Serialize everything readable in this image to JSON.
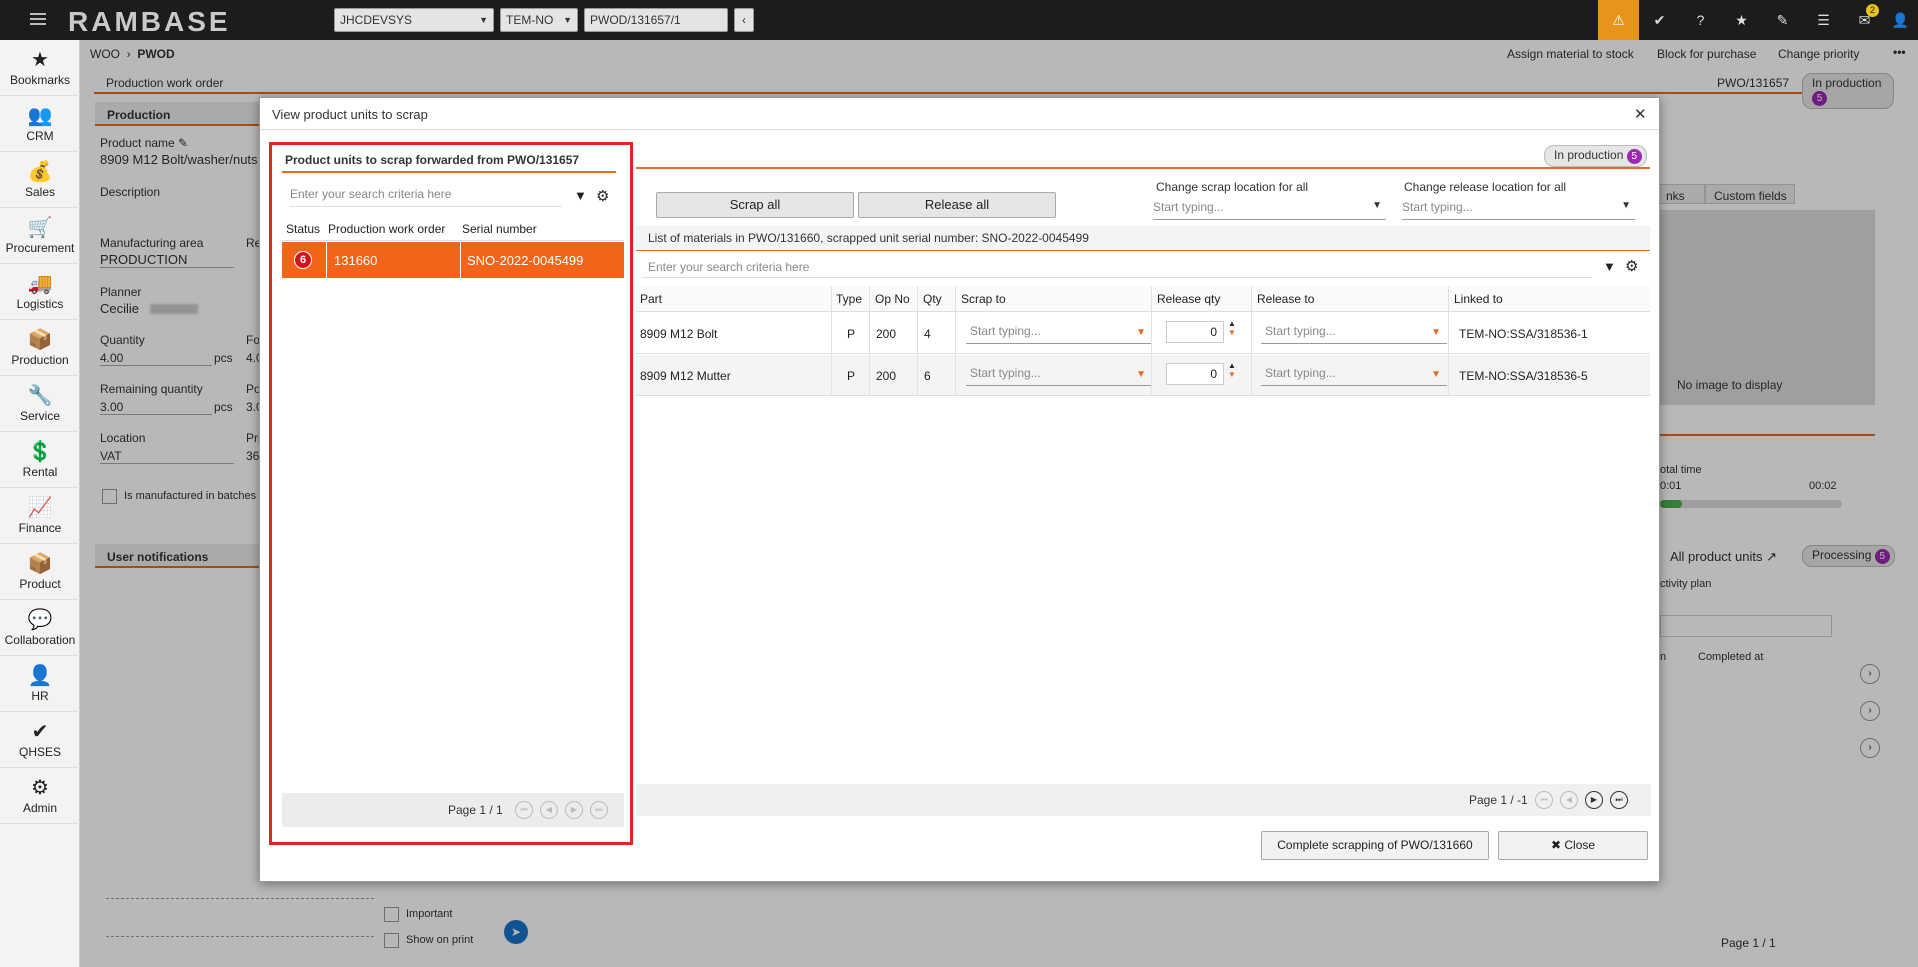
{
  "topbar": {
    "logo": "RAMBASE",
    "company": "JHCDEVSYS",
    "region": "TEM-NO",
    "document": "PWOD/131657/1",
    "notification_count": "2"
  },
  "sidebar": {
    "items": [
      {
        "label": "Bookmarks",
        "icon": "★"
      },
      {
        "label": "CRM",
        "icon": "👥"
      },
      {
        "label": "Sales",
        "icon": "💰"
      },
      {
        "label": "Procurement",
        "icon": "🛒"
      },
      {
        "label": "Logistics",
        "icon": "🚚"
      },
      {
        "label": "Production",
        "icon": "📦"
      },
      {
        "label": "Service",
        "icon": "🔧"
      },
      {
        "label": "Rental",
        "icon": "💲"
      },
      {
        "label": "Finance",
        "icon": "📈"
      },
      {
        "label": "Product",
        "icon": "📦"
      },
      {
        "label": "Collaboration",
        "icon": "💬"
      },
      {
        "label": "HR",
        "icon": "👤"
      },
      {
        "label": "QHSES",
        "icon": "✔"
      },
      {
        "label": "Admin",
        "icon": "⚙"
      }
    ]
  },
  "page": {
    "breadcrumb_root": "WOO",
    "breadcrumb_current": "PWOD",
    "actions": [
      "Assign material to stock",
      "Block for purchase",
      "Change priority"
    ],
    "section_title": "Production work order",
    "doc_id": "PWO/131657",
    "status": "In production",
    "status_num": "5",
    "production_tab": "Production",
    "product_name_label": "Product name",
    "product_name": "8909 M12 Bolt/washer/nuts",
    "description_label": "Description",
    "mfg_area_label": "Manufacturing area",
    "mfg_area": "PRODUCTION",
    "re_label": "Re",
    "planner_label": "Planner",
    "planner": "Cecilie",
    "quantity_label": "Quantity",
    "quantity": "4.00",
    "quantity_unit": "pcs",
    "quantity_right": "4.0",
    "fo_label": "Fo",
    "remaining_label": "Remaining quantity",
    "remaining": "3.00",
    "remaining_unit": "pcs",
    "remaining_right": "3.0",
    "po_label": "Po",
    "location_label": "Location",
    "location": "VAT",
    "pri_label": "Pri",
    "location_right": "36",
    "batches_label": "Is manufactured in batches",
    "user_notif": "User notifications",
    "important": "Important",
    "show_on_print": "Show on print",
    "links_tab": "nks",
    "custom_fields_tab": "Custom fields",
    "no_image": "No image to display",
    "total_time_label": "otal time",
    "time_left": "0:01",
    "time_right": "00:02",
    "all_units_tab": "All product units",
    "processing": "Processing",
    "processing_num": "5",
    "activity_plan": "ctivity plan",
    "col_n": "n",
    "col_completed": "Completed at",
    "pager_bg": "Page 1 / 1"
  },
  "dialog": {
    "title": "View product units to scrap",
    "left": {
      "title": "Product units to scrap forwarded from PWO/131657",
      "search_placeholder": "Enter your search criteria here",
      "headers": [
        "Status",
        "Production work order",
        "Serial number"
      ],
      "rows": [
        {
          "status": "6",
          "pwo": "131660",
          "serial": "SNO-2022-0045499"
        }
      ],
      "pager": "Page 1 / 1"
    },
    "right": {
      "status": "In production",
      "status_num": "5",
      "scrap_all": "Scrap all",
      "release_all": "Release all",
      "scrap_loc_label": "Change scrap location for all",
      "release_loc_label": "Change release location for all",
      "start_typing": "Start typing...",
      "list_title": "List of materials in PWO/131660, scrapped unit serial number: SNO-2022-0045499",
      "search_placeholder": "Enter your search criteria here",
      "headers": [
        "Part",
        "Type",
        "Op No",
        "Qty",
        "Scrap to",
        "Release qty",
        "Release to",
        "Linked to"
      ],
      "rows": [
        {
          "part": "8909 M12 Bolt",
          "type": "P",
          "op": "200",
          "qty": "4",
          "scrap": "Start typing...",
          "rel_qty": "0",
          "release": "Start typing...",
          "linked": "TEM-NO:SSA/318536-1"
        },
        {
          "part": "8909 M12 Mutter",
          "type": "P",
          "op": "200",
          "qty": "6",
          "scrap": "Start typing...",
          "rel_qty": "0",
          "release": "Start typing...",
          "linked": "TEM-NO:SSA/318536-5"
        }
      ],
      "pager": "Page 1 / -1"
    },
    "complete_btn": "Complete scrapping of PWO/131660",
    "close_btn": "Close"
  }
}
